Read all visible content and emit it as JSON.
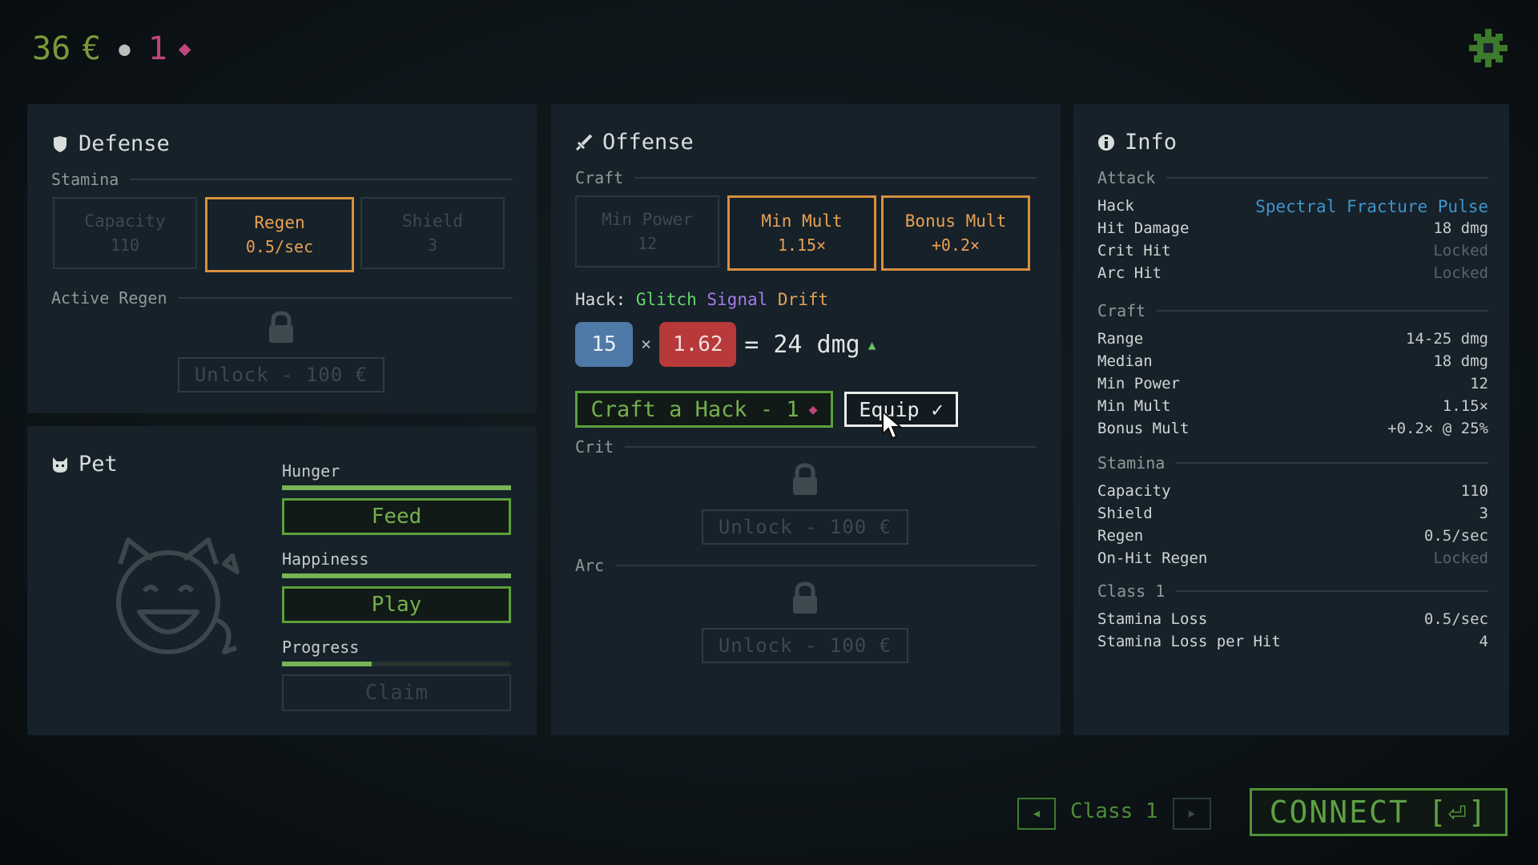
{
  "top": {
    "euro_amount": "36",
    "euro_symbol": "€",
    "gem_amount": "1"
  },
  "colors": {
    "accent_green": "#5ba039",
    "accent_orange": "#d98f3e",
    "gem_pink": "#c0457e",
    "hack_blue": "#3f94c9"
  },
  "defense": {
    "title": "Defense",
    "stamina_section": "Stamina",
    "cards": [
      {
        "label": "Capacity",
        "value": "110",
        "active": false
      },
      {
        "label": "Regen",
        "value": "0.5/sec",
        "active": true
      },
      {
        "label": "Shield",
        "value": "3",
        "active": false
      }
    ],
    "active_regen_section": "Active Regen",
    "unlock_label": "Unlock - 100 €"
  },
  "pet": {
    "title": "Pet",
    "hunger": {
      "label": "Hunger",
      "fill": 1.0
    },
    "feed_label": "Feed",
    "happiness": {
      "label": "Happiness",
      "fill": 1.0
    },
    "play_label": "Play",
    "progress": {
      "label": "Progress",
      "fill": 0.39
    },
    "claim_label": "Claim"
  },
  "offense": {
    "title": "Offense",
    "craft_section": "Craft",
    "cards": [
      {
        "label": "Min Power",
        "value": "12",
        "active": false
      },
      {
        "label": "Min Mult",
        "value": "1.15×",
        "active": true
      },
      {
        "label": "Bonus Mult",
        "value": "+0.2×",
        "active": true
      }
    ],
    "hack_prefix": "Hack:",
    "hack_words": [
      "Glitch",
      "Signal",
      "Drift"
    ],
    "power": "15",
    "times": "×",
    "mult": "1.62",
    "result": "= 24 dmg",
    "up_arrow": "▲",
    "craft_button": "Craft a Hack - 1",
    "equip_button": "Equip ✓",
    "crit_section": "Crit",
    "arc_section": "Arc",
    "unlock_label": "Unlock - 100 €"
  },
  "info": {
    "title": "Info",
    "attack_section": "Attack",
    "attack_rows": [
      {
        "label": "Hack",
        "value": "Spectral Fracture Pulse"
      },
      {
        "label": "Hit Damage",
        "value": "18 dmg"
      },
      {
        "label": "Crit Hit",
        "value": "Locked"
      },
      {
        "label": "Arc Hit",
        "value": "Locked"
      }
    ],
    "craft_section": "Craft",
    "craft_rows": [
      {
        "label": "Range",
        "value": "14-25 dmg"
      },
      {
        "label": "Median",
        "value": "18 dmg"
      },
      {
        "label": "Min Power",
        "value": "12"
      },
      {
        "label": "Min Mult",
        "value": "1.15×"
      },
      {
        "label": "Bonus Mult",
        "value": "+0.2× @ 25%"
      }
    ],
    "stamina_section": "Stamina",
    "stamina_rows": [
      {
        "label": "Capacity",
        "value": "110"
      },
      {
        "label": "Shield",
        "value": "3"
      },
      {
        "label": "Regen",
        "value": "0.5/sec"
      },
      {
        "label": "On-Hit Regen",
        "value": "Locked"
      }
    ],
    "class_section": "Class 1",
    "class_rows": [
      {
        "label": "Stamina Loss",
        "value": "0.5/sec"
      },
      {
        "label": "Stamina Loss per Hit",
        "value": "4"
      }
    ]
  },
  "bottom": {
    "class_label": "Class 1",
    "connect_label": "CONNECT",
    "connect_icon": "[⏎]"
  }
}
